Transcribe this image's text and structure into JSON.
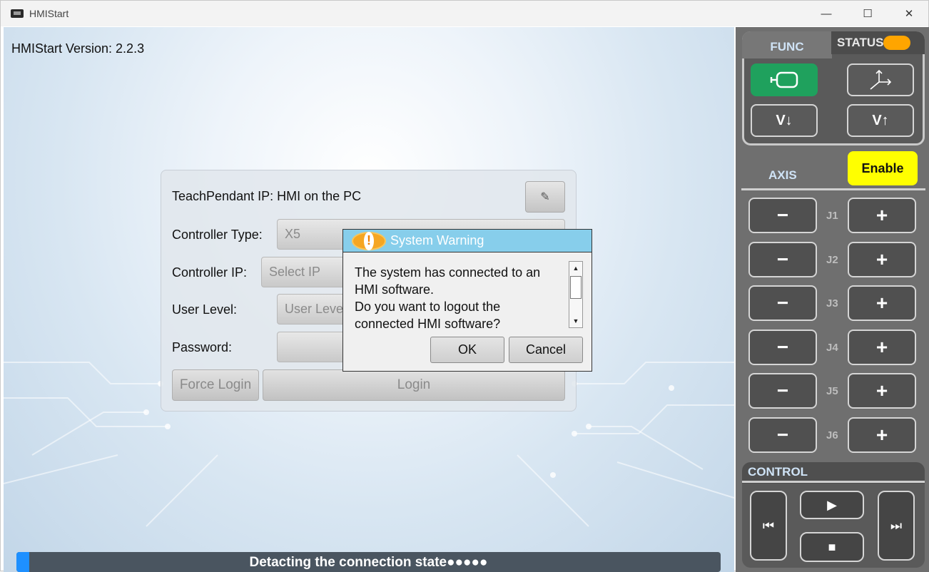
{
  "window": {
    "title": "HMIStart",
    "min_icon": "minimize-icon",
    "max_icon": "maximize-icon",
    "close_icon": "close-icon"
  },
  "main": {
    "version_text": "HMIStart Version: 2.2.3",
    "login": {
      "teach_pendant_label": "TeachPendant IP: HMI on the PC",
      "controller_type_label": "Controller Type:",
      "controller_type_value": "X5",
      "controller_ip_label": "Controller IP:",
      "controller_ip_placeholder": "Select IP",
      "user_level_label": "User Level:",
      "user_level_placeholder": "User Level",
      "password_label": "Password:",
      "force_login_label": "Force Login",
      "login_label": "Login"
    },
    "dialog": {
      "title": "System Warning",
      "message_line1": "The system has connected to an",
      "message_line2": "HMI software.",
      "message_line3": "Do you want to logout the",
      "message_line4": "connected HMI software?",
      "ok_label": "OK",
      "cancel_label": "Cancel"
    },
    "status": {
      "text": "Detacting the connection state●●●●●",
      "progress": 0.02
    }
  },
  "side": {
    "func_label": "FUNC",
    "status_label": "STATUS",
    "status_color": "#ffa500",
    "func_buttons": [
      {
        "name": "tool-frame-button",
        "icon": "tool-icon",
        "label": ""
      },
      {
        "name": "coordinate-button",
        "icon": "axes-icon",
        "label": ""
      },
      {
        "name": "velocity-down-button",
        "label": "V↓"
      },
      {
        "name": "velocity-up-button",
        "label": "V↑"
      }
    ],
    "axis_label": "AXIS",
    "enable_label": "Enable",
    "joints": [
      {
        "label": "J1",
        "minus": "−",
        "plus": "+"
      },
      {
        "label": "J2",
        "minus": "−",
        "plus": "+"
      },
      {
        "label": "J3",
        "minus": "−",
        "plus": "+"
      },
      {
        "label": "J4",
        "minus": "−",
        "plus": "+"
      },
      {
        "label": "J5",
        "minus": "−",
        "plus": "+"
      },
      {
        "label": "J6",
        "minus": "−",
        "plus": "+"
      }
    ],
    "control_label": "CONTROL",
    "control_buttons": {
      "prev": "⏮",
      "play": "▶",
      "stop": "■",
      "next": "⏭"
    }
  }
}
